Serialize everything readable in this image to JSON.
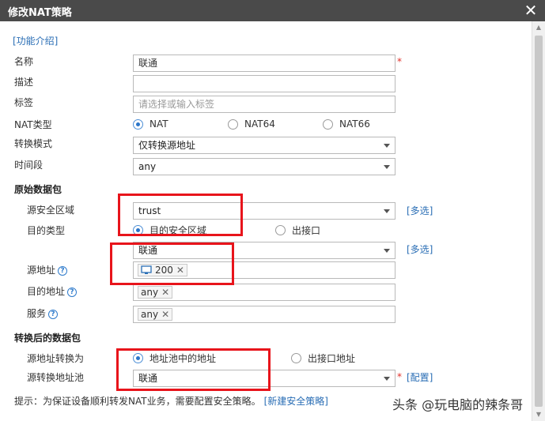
{
  "dialog": {
    "title": "修改NAT策略"
  },
  "intro_link": "[功能介绍]",
  "fields": {
    "name": {
      "label": "名称",
      "value": "联通"
    },
    "desc": {
      "label": "描述",
      "value": ""
    },
    "tag": {
      "label": "标签",
      "placeholder": "请选择或输入标签"
    },
    "nat_type": {
      "label": "NAT类型",
      "options": [
        "NAT",
        "NAT64",
        "NAT66"
      ],
      "selected": "NAT"
    },
    "convert_mode": {
      "label": "转换模式",
      "value": "仅转换源地址"
    },
    "time_range": {
      "label": "时间段",
      "value": "any"
    }
  },
  "original": {
    "heading": "原始数据包",
    "src_zone": {
      "label": "源安全区域",
      "value": "trust",
      "multi": "[多选]"
    },
    "dst_type": {
      "label": "目的类型",
      "options": [
        "目的安全区域",
        "出接口"
      ],
      "selected": "目的安全区域"
    },
    "dst_zone": {
      "value": "联通",
      "multi": "[多选]"
    },
    "src_addr": {
      "label": "源地址",
      "chip": "200"
    },
    "dst_addr": {
      "label": "目的地址",
      "chip": "any"
    },
    "service": {
      "label": "服务",
      "chip": "any"
    }
  },
  "translated": {
    "heading": "转换后的数据包",
    "src_convert": {
      "label": "源地址转换为",
      "options": [
        "地址池中的地址",
        "出接口地址"
      ],
      "selected": "地址池中的地址"
    },
    "pool": {
      "label": "源转换地址池",
      "value": "联通",
      "config": "[配置]"
    }
  },
  "hint": {
    "text": "提示：为保证设备顺利转发NAT业务，需要配置安全策略。",
    "link": "[新建安全策略]"
  },
  "required_mark": "*",
  "watermark": "头条 @玩电脑的辣条哥",
  "colors": {
    "titlebar": "#4a4a4a",
    "link": "#2a6eb5",
    "highlight": "#e8141b"
  }
}
